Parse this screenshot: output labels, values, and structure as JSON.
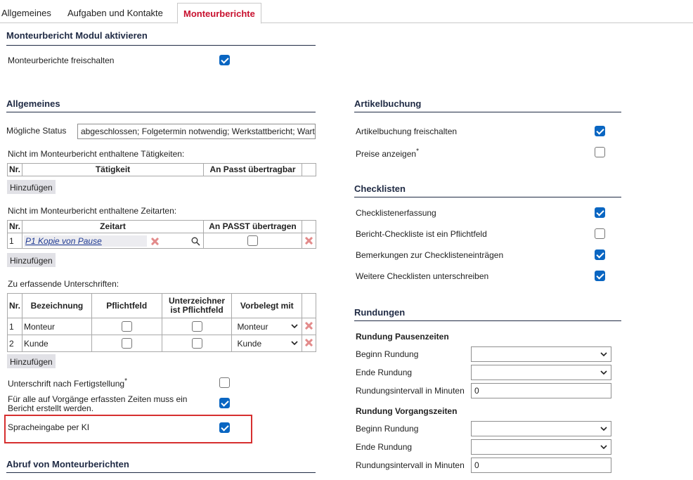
{
  "tabs": [
    {
      "label": "Allgemeines",
      "active": false
    },
    {
      "label": "Aufgaben und Kontakte",
      "active": false
    },
    {
      "label": "Monteurberichte",
      "active": true
    }
  ],
  "colors": {
    "accent": "#c8102e",
    "checkbox": "#0a66c2",
    "heading": "#1f2a44",
    "highlight": "#d62f2f"
  },
  "module": {
    "title": "Monteurbericht Modul aktivieren",
    "enable_label": "Monteurberichte freischalten",
    "enable_checked": true
  },
  "general": {
    "title": "Allgemeines",
    "status_label": "Mögliche Status",
    "status_value": "abgeschlossen; Folgetermin notwendig; Werkstattbericht; Wart",
    "activities": {
      "caption": "Nicht im Monteurbericht enthaltene Tätigkeiten:",
      "headers": [
        "Nr.",
        "Tätigkeit",
        "An Passt übertragbar"
      ],
      "add_label": "Hinzufügen"
    },
    "timetypes": {
      "caption": "Nicht im Monteurbericht enthaltene Zeitarten:",
      "headers": [
        "Nr.",
        "Zeitart",
        "An PASST übertragen"
      ],
      "rows": [
        {
          "nr": "1",
          "name": "P1 Kopie von Pause",
          "checked": false
        }
      ],
      "add_label": "Hinzufügen"
    },
    "signatures": {
      "caption": "Zu erfassende Unterschriften:",
      "headers": [
        "Nr.",
        "Bezeichnung",
        "Pflichtfeld",
        "Unterzeichner ist Pflichtfeld",
        "Vorbelegt mit"
      ],
      "rows": [
        {
          "nr": "1",
          "name": "Monteur",
          "preset": "Monteur"
        },
        {
          "nr": "2",
          "name": "Kunde",
          "preset": "Kunde"
        }
      ],
      "add_label": "Hinzufügen"
    },
    "sign_after_label": "Unterschrift nach Fertigstellung",
    "sign_after_star": "*",
    "sign_after_checked": false,
    "report_all_label": "Für alle auf Vorgänge erfassten Zeiten muss ein Bericht erstellt werden.",
    "report_all_checked": true,
    "voice_label": "Spracheingabe per KI",
    "voice_checked": true
  },
  "retrieval": {
    "title": "Abruf von Monteurberichten"
  },
  "articles": {
    "title": "Artikelbuchung",
    "items": [
      {
        "label": "Artikelbuchung freischalten",
        "star": "",
        "checked": true
      },
      {
        "label": "Preise anzeigen",
        "star": "*",
        "checked": false
      }
    ]
  },
  "checklists": {
    "title": "Checklisten",
    "items": [
      {
        "label": "Checklistenerfassung",
        "checked": true
      },
      {
        "label": "Bericht-Checkliste ist ein Pflichtfeld",
        "checked": false
      },
      {
        "label": "Bemerkungen zur Checklisteneinträgen",
        "checked": true
      },
      {
        "label": "Weitere Checklisten unterschreiben",
        "checked": true
      }
    ]
  },
  "rounding": {
    "title": "Rundungen",
    "pause": {
      "title": "Rundung Pausenzeiten",
      "begin_label": "Beginn Rundung",
      "begin_value": "",
      "end_label": "Ende Rundung",
      "end_value": "",
      "interval_label": "Rundungsintervall in Minuten",
      "interval_value": "0"
    },
    "process": {
      "title": "Rundung Vorgangszeiten",
      "begin_label": "Beginn Rundung",
      "begin_value": "",
      "end_label": "Ende Rundung",
      "end_value": "",
      "interval_label": "Rundungsintervall in Minuten",
      "interval_value": "0"
    }
  }
}
